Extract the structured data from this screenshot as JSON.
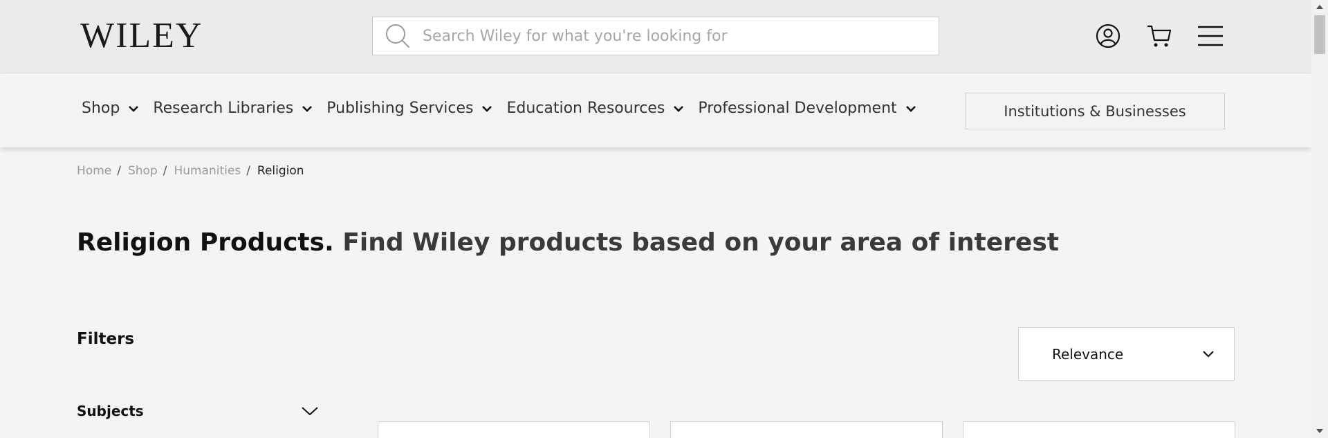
{
  "header": {
    "logo": "WILEY",
    "search_placeholder": "Search Wiley for what you're looking for",
    "icons": [
      "account-icon",
      "cart-icon",
      "menu-icon"
    ]
  },
  "nav": {
    "items": [
      {
        "label": "Shop"
      },
      {
        "label": "Research Libraries"
      },
      {
        "label": "Publishing Services"
      },
      {
        "label": "Education Resources"
      },
      {
        "label": "Professional Development"
      }
    ],
    "institutions_button": "Institutions & Businesses"
  },
  "breadcrumb": {
    "items": [
      "Home",
      "Shop",
      "Humanities"
    ],
    "current": "Religion",
    "separator": "/"
  },
  "page": {
    "title_bold": "Religion Products.",
    "title_rest": "Find Wiley products based on your area of interest"
  },
  "filters": {
    "label": "Filters",
    "subjects_label": "Subjects"
  },
  "sort": {
    "selected": "Relevance"
  },
  "colors": {
    "header_bg": "#ebebeb",
    "nav_bg": "#f3f3f3",
    "page_bg": "#f4f4f4",
    "text": "#1a1a1a"
  }
}
